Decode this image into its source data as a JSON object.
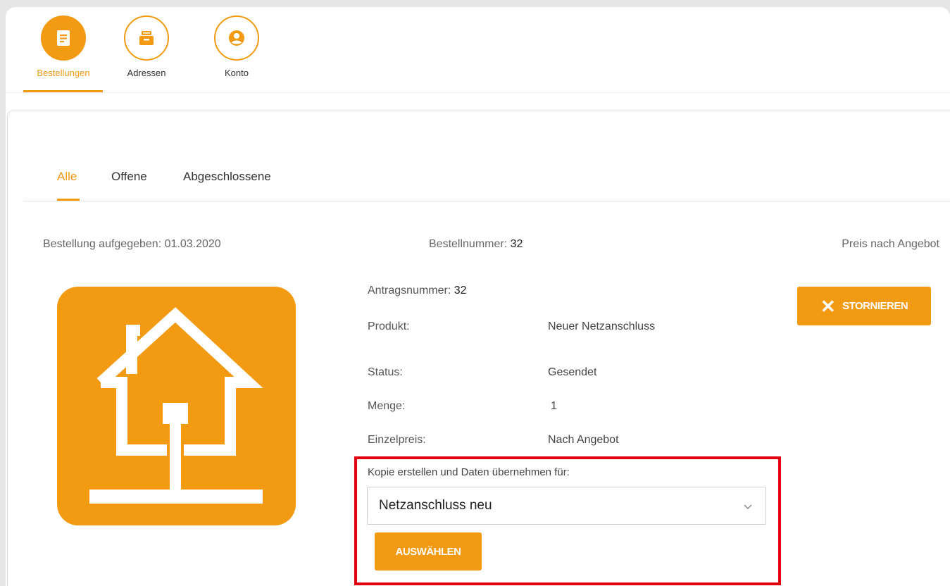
{
  "nav": {
    "items": [
      {
        "label": "Bestellungen",
        "icon": "orders-icon",
        "active": true
      },
      {
        "label": "Adressen",
        "icon": "address-box-icon",
        "active": false
      },
      {
        "label": "Konto",
        "icon": "account-icon",
        "active": false
      }
    ]
  },
  "tabs": [
    {
      "label": "Alle",
      "active": true
    },
    {
      "label": "Offene",
      "active": false
    },
    {
      "label": "Abgeschlossene",
      "active": false
    }
  ],
  "order": {
    "placed_label": "Bestellung aufgegeben:",
    "placed_date": "01.03.2020",
    "number_label": "Bestellnummer:",
    "number_value": "32",
    "price_note": "Preis nach Angebot",
    "application_label": "Antragsnummer:",
    "application_value": "32",
    "fields": [
      {
        "label": "Produkt:",
        "value": "Neuer Netzanschluss"
      },
      {
        "label": "Status:",
        "value": "Gesendet"
      },
      {
        "label": "Menge:",
        "value": "1"
      },
      {
        "label": "Einzelpreis:",
        "value": "Nach Angebot"
      }
    ],
    "product_icon": "house-connection-icon",
    "cancel_label": "STORNIEREN"
  },
  "copy": {
    "label": "Kopie erstellen und Daten übernehmen für:",
    "selected": "Netzanschluss neu",
    "button_label": "AUSWÄHLEN"
  },
  "colors": {
    "accent": "#f39a13",
    "highlight": "#e3000f"
  }
}
